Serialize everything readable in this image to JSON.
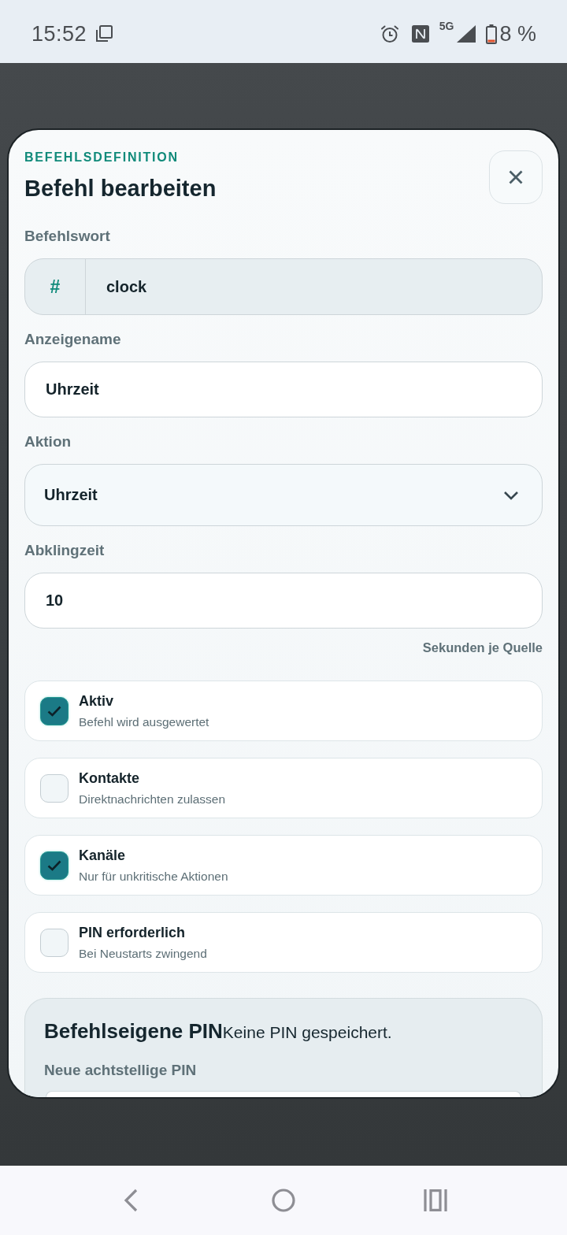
{
  "status_bar": {
    "time": "15:52",
    "network": "5G",
    "battery": "8 %"
  },
  "dialog": {
    "overline": "BEFEHLSDEFINITION",
    "title": "Befehl bearbeiten",
    "fields": [
      {
        "kind": "prefixed",
        "label": "Befehlswort",
        "prefix": "#",
        "value": "clock",
        "disabled": true
      },
      {
        "kind": "text",
        "label": "Anzeigename",
        "value": "Uhrzeit",
        "disabled": false
      },
      {
        "kind": "select",
        "label": "Aktion",
        "value": "Uhrzeit",
        "disabled": false
      },
      {
        "kind": "text",
        "label": "Abklingzeit",
        "value": "10",
        "hint": "Sekunden je Quelle",
        "disabled": false
      }
    ],
    "options": [
      {
        "title": "Aktiv",
        "subtitle": "Befehl wird ausgewertet",
        "checked": true
      },
      {
        "title": "Kontakte",
        "subtitle": "Direktnachrichten zulassen",
        "checked": false
      },
      {
        "title": "Kanäle",
        "subtitle": "Nur für unkritische Aktionen",
        "checked": true
      },
      {
        "title": "PIN erforderlich",
        "subtitle": "Bei Neustarts zwingend",
        "checked": false
      }
    ],
    "pin_section": {
      "title": "Befehlseigene PIN",
      "status": "Keine PIN gespeichert.",
      "field_label": "Neue achtstellige PIN"
    }
  }
}
